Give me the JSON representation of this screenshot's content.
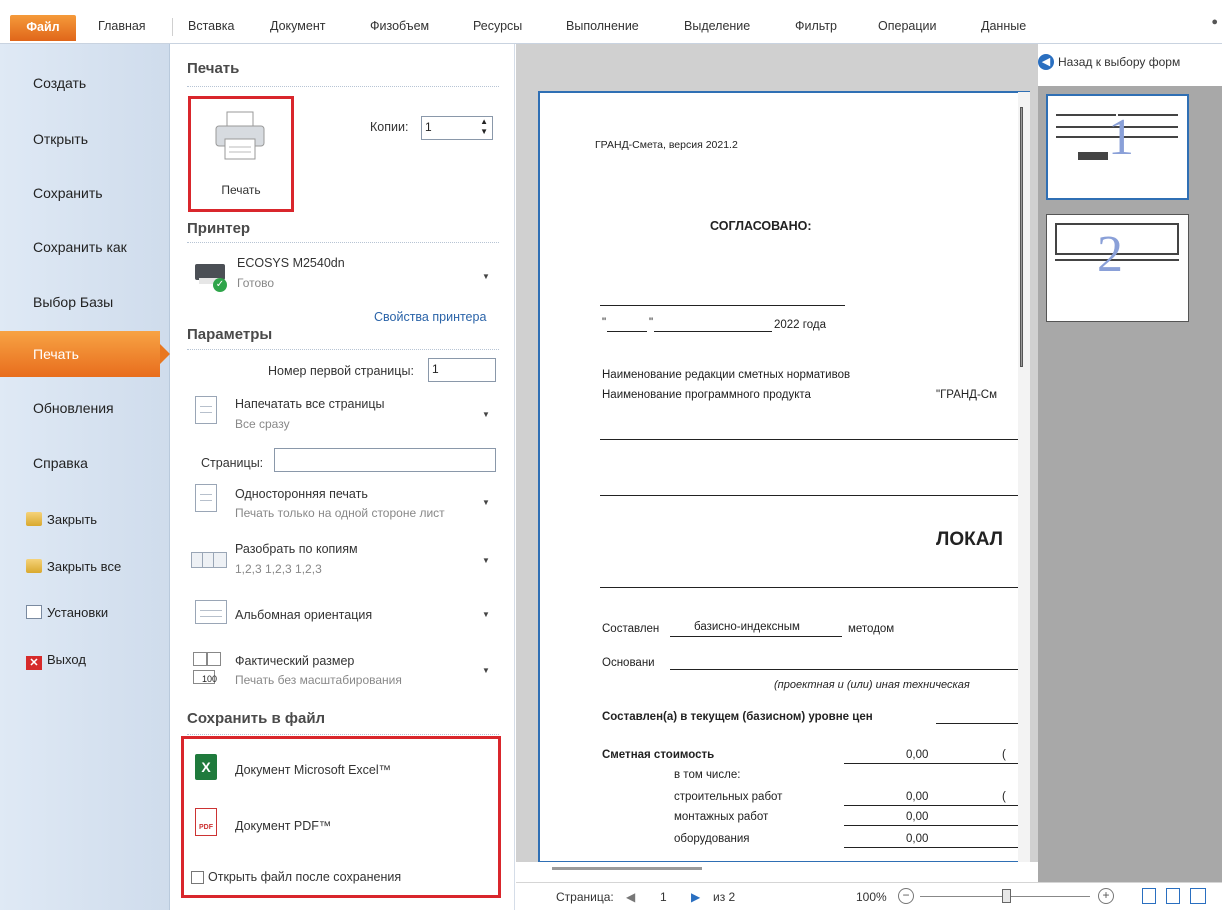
{
  "ribbon": {
    "tabs": [
      "Файл",
      "Главная",
      "Вставка",
      "Документ",
      "Физобъем",
      "Ресурсы",
      "Выполнение",
      "Выделение",
      "Фильтр",
      "Операции",
      "Данные"
    ]
  },
  "nav": {
    "items": [
      "Создать",
      "Открыть",
      "Сохранить",
      "Сохранить как",
      "Выбор Базы",
      "Печать",
      "Обновления",
      "Справка"
    ],
    "small": [
      "Закрыть",
      "Закрыть все",
      "Установки",
      "Выход"
    ]
  },
  "print": {
    "title": "Печать",
    "button": "Печать",
    "copies_label": "Копии:",
    "copies_value": "1",
    "printer_title": "Принтер",
    "printer_name": "ECOSYS M2540dn",
    "printer_status": "Готово",
    "printer_props": "Свойства принтера",
    "params_title": "Параметры",
    "first_page_label": "Номер первой страницы:",
    "first_page_value": "1",
    "print_all": "Напечатать все страницы",
    "print_all_sub": "Все сразу",
    "pages_label": "Страницы:",
    "pages_value": "",
    "duplex": "Односторонняя печать",
    "duplex_sub": "Печать только на одной стороне лист",
    "collate": "Разобрать по копиям",
    "collate_sub": "1,2,3  1,2,3  1,2,3",
    "orientation": "Альбомная ориентация",
    "size": "Фактический размер",
    "size_sub": "Печать без масштабирования",
    "size_icon_text": "100",
    "save_title": "Сохранить в файл",
    "excel": "Документ Microsoft Excel™",
    "pdf": "Документ PDF™",
    "open_after": "Открыть файл после сохранения"
  },
  "preview": {
    "version": "ГРАНД-Смета, версия 2021.2",
    "agreed": "СОГЛАСОВАНО:",
    "quote_l": "\"",
    "quote_r": "\"",
    "year": "2022 года",
    "ed_name": "Наименование редакции сметных нормативов",
    "prog_name": "Наименование программного продукта",
    "prog_value": "\"ГРАНД-См",
    "heading": "ЛОКАЛ",
    "composed": "Составлен",
    "method_value": "базисно-индексным",
    "method": "методом",
    "basis": "Основани",
    "basis_note": "(проектная и (или) иная техническая",
    "level": "Составлен(а) в текущем (базисном) уровне цен",
    "cost": "Сметная стоимость",
    "cost_val": "0,00",
    "incl": "в том числе:",
    "build": "строительных работ",
    "build_val": "0,00",
    "mount": "монтажных работ",
    "mount_val": "0,00",
    "equip": "оборудования",
    "equip_val": "0,00",
    "paren": "("
  },
  "thumbs": {
    "back": "Назад к выбору форм",
    "page1": "1",
    "page2": "2"
  },
  "status": {
    "page_label": "Страница:",
    "page": "1",
    "of": "из 2",
    "zoom": "100%"
  }
}
